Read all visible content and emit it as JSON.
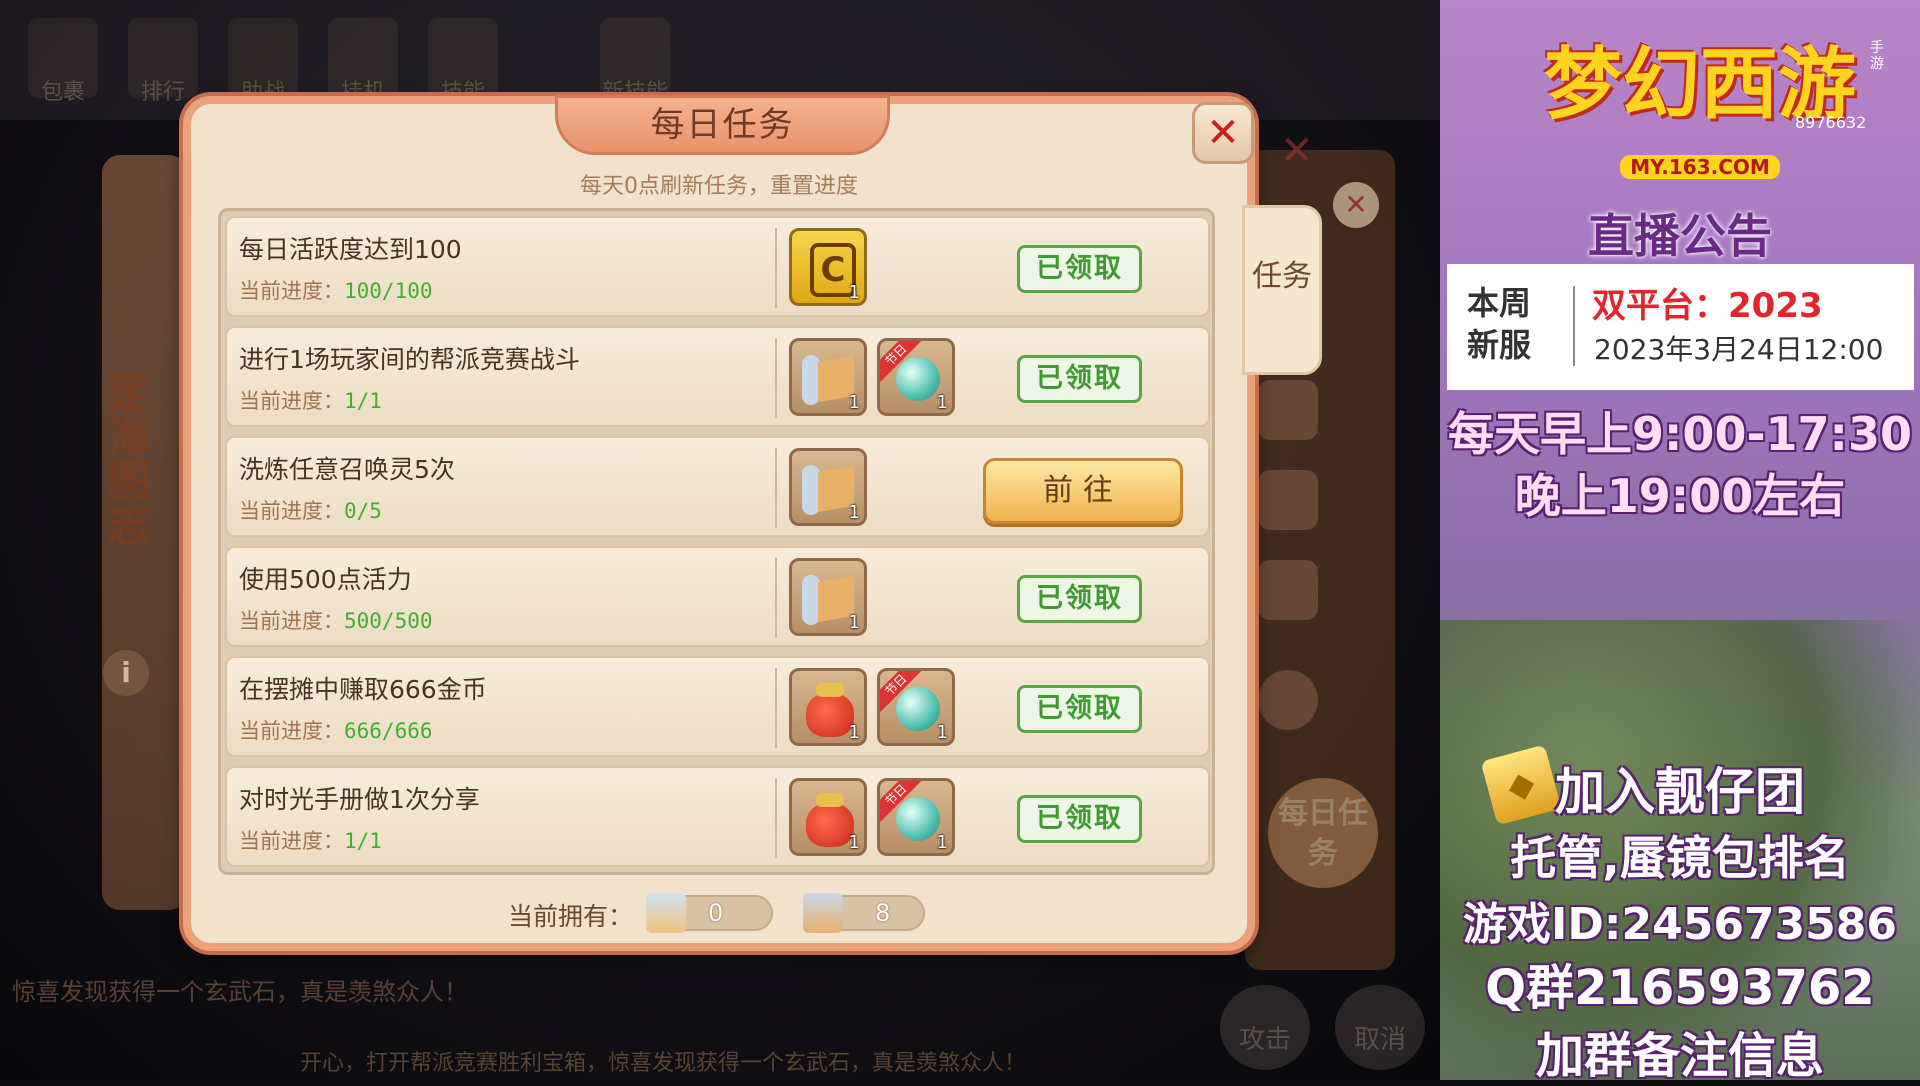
{
  "game": {
    "top_icons": [
      "包裹",
      "排行",
      "助战",
      "挂机",
      "技能",
      "",
      "新技能"
    ],
    "side_panel": {
      "title": "定海图志",
      "info": "i"
    },
    "background_daily": "每日任务",
    "chat_log": "惊喜发现获得一个玄武石，真是羡煞众人！",
    "ticker": "开心，打开帮派竞赛胜利宝箱，惊喜发现获得一个玄武石，真是羡煞众人！",
    "bottom_buttons": [
      "攻击",
      "取消"
    ]
  },
  "dialog": {
    "title": "每日任务",
    "close": "✕",
    "subtitle": "每天0点刷新任务，重置进度",
    "side_tab": "任务",
    "progress_label": "当前进度：",
    "claimed_label": "已领取",
    "go_label": "前往",
    "tasks": [
      {
        "name": "每日活跃度达到100",
        "progress": "100/100",
        "status": "claimed",
        "rewards": [
          {
            "icon": "gold-card-icon",
            "qty": "1",
            "tag": ""
          }
        ]
      },
      {
        "name": "进行1场玩家间的帮派竞赛战斗",
        "progress": "1/1",
        "status": "claimed",
        "rewards": [
          {
            "icon": "scroll-icon",
            "qty": "1",
            "tag": ""
          },
          {
            "icon": "pearl-icon",
            "qty": "1",
            "tag": "节日"
          }
        ]
      },
      {
        "name": "洗炼任意召唤灵5次",
        "progress": "0/5",
        "status": "go",
        "rewards": [
          {
            "icon": "scroll-icon",
            "qty": "1",
            "tag": ""
          }
        ]
      },
      {
        "name": "使用500点活力",
        "progress": "500/500",
        "status": "claimed",
        "rewards": [
          {
            "icon": "scroll-icon",
            "qty": "1",
            "tag": ""
          }
        ]
      },
      {
        "name": "在摆摊中赚取666金币",
        "progress": "666/666",
        "status": "claimed",
        "rewards": [
          {
            "icon": "lucky-bag-icon",
            "qty": "1",
            "tag": ""
          },
          {
            "icon": "pearl-icon",
            "qty": "1",
            "tag": "节日"
          }
        ]
      },
      {
        "name": "对时光手册做1次分享",
        "progress": "1/1",
        "status": "claimed",
        "rewards": [
          {
            "icon": "lucky-bag-icon",
            "qty": "1",
            "tag": ""
          },
          {
            "icon": "pearl-icon",
            "qty": "1",
            "tag": "节日"
          }
        ]
      }
    ],
    "owned_label": "当前拥有：",
    "owned": [
      {
        "icon": "blue-scroll-icon",
        "value": "0"
      },
      {
        "icon": "scroll-icon",
        "value": "8"
      }
    ]
  },
  "stream": {
    "logo": "梦幻西游",
    "logo_url": "MY.163.COM",
    "logo_id": "8976632",
    "mobile_tag": "手游",
    "notice_title": "直播公告",
    "notice_label": "本周新服",
    "notice_platform": "双平台：2023",
    "notice_date": "2023年3月24日12:00",
    "schedule_1": "每天早上9:00-17:30",
    "schedule_2": "晚上19:00左右",
    "join": "加入靓仔团",
    "service": "托管,蜃镜包排名",
    "game_id": "游戏ID:245673586",
    "qq_group": "Q群216593762",
    "note": "加群备注信息"
  },
  "colors": {
    "accent": "#e9a27a",
    "claimed": "#3e9a31",
    "progress": "#41b02e",
    "close": "#c91e1e",
    "go": "#f1b34f"
  }
}
